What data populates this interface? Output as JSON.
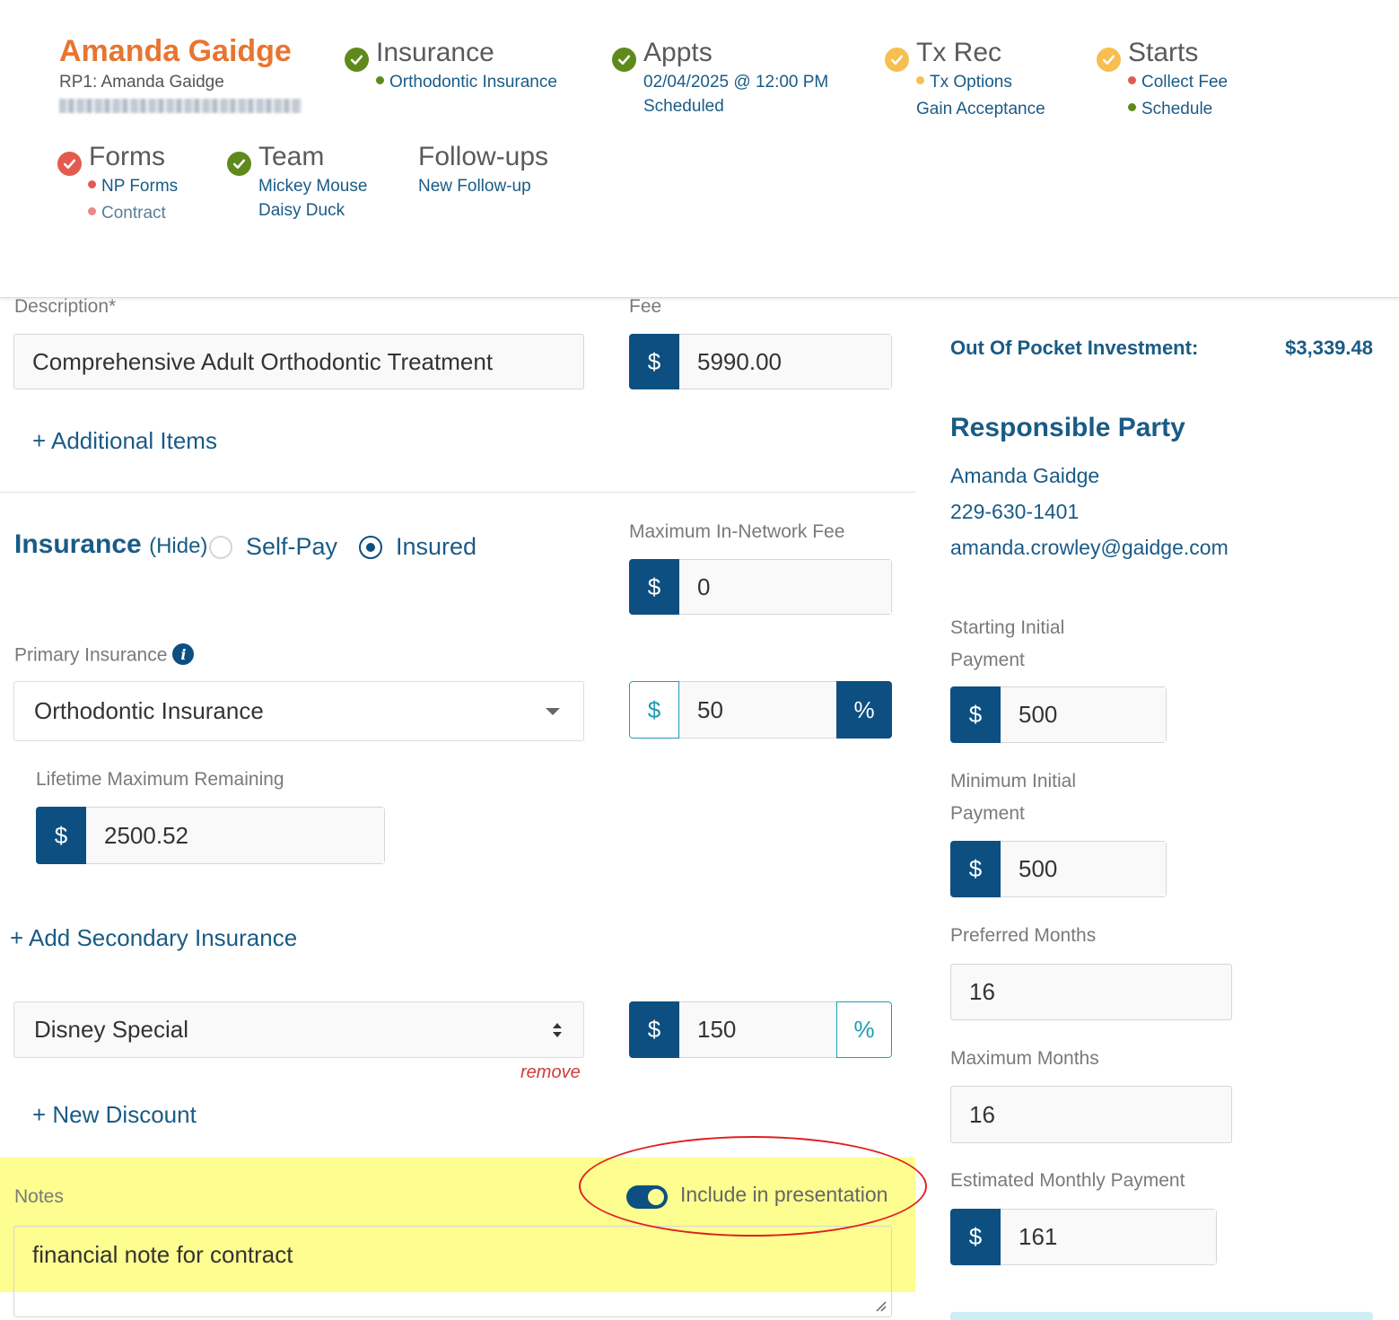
{
  "patient": {
    "name": "Amanda Gaidge",
    "rp": "RP1: Amanda Gaidge"
  },
  "stages": {
    "insurance": {
      "title": "Insurance",
      "status": "complete",
      "items": [
        "Orthodontic Insurance"
      ]
    },
    "appts": {
      "title": "Appts",
      "status": "complete",
      "items": [
        "02/04/2025 @ 12:00 PM",
        "Scheduled"
      ]
    },
    "txrec": {
      "title": "Tx Rec",
      "status": "pending",
      "items": [
        "Tx Options",
        "Gain Acceptance"
      ]
    },
    "starts": {
      "title": "Starts",
      "status": "pending",
      "items": [
        "Collect Fee",
        "Schedule"
      ]
    },
    "forms": {
      "title": "Forms",
      "status": "incomplete",
      "items": [
        "NP Forms",
        "Contract"
      ]
    },
    "team": {
      "title": "Team",
      "status": "complete",
      "items": [
        "Mickey Mouse",
        "Daisy Duck"
      ]
    },
    "followups": {
      "title": "Follow-ups",
      "items": [
        "New Follow-up"
      ]
    }
  },
  "form": {
    "description_label": "Description*",
    "description_value": "Comprehensive Adult Orthodontic Treatment",
    "fee_label": "Fee",
    "fee_value": "5990.00",
    "additional_items": "+ Additional Items",
    "insurance_heading": "Insurance",
    "insurance_hide": "(Hide)",
    "self_pay": "Self-Pay",
    "insured": "Insured",
    "max_in_network_label": "Maximum In-Network Fee",
    "max_in_network_value": "0",
    "primary_insurance_label": "Primary Insurance",
    "primary_insurance_value": "Orthodontic Insurance",
    "coverage_value": "50",
    "lifetime_max_label": "Lifetime Maximum Remaining",
    "lifetime_max_value": "2500.52",
    "add_secondary": "+ Add Secondary Insurance",
    "discount_value": "Disney Special",
    "discount_amount": "150",
    "remove": "remove",
    "new_discount": "+ New Discount",
    "notes_label": "Notes",
    "include_presentation": "Include in presentation",
    "notes_value": "financial note for contract",
    "currency_symbol": "$",
    "percent_symbol": "%"
  },
  "summary": {
    "oop_label": "Out Of Pocket Investment:",
    "oop_value": "$3,339.48",
    "rp_heading": "Responsible Party",
    "rp_name": "Amanda Gaidge",
    "rp_phone": "229-630-1401",
    "rp_email": "amanda.crowley@gaidge.com",
    "starting_initial_label_1": "Starting Initial",
    "starting_initial_label_2": "Payment",
    "starting_initial_value": "500",
    "minimum_initial_label_1": "Minimum Initial",
    "minimum_initial_label_2": "Payment",
    "minimum_initial_value": "500",
    "preferred_months_label": "Preferred Months",
    "preferred_months_value": "16",
    "maximum_months_label": "Maximum Months",
    "maximum_months_value": "16",
    "estimated_monthly_label": "Estimated Monthly Payment",
    "estimated_monthly_value": "161"
  },
  "colors": {
    "brand_orange": "#e8752f",
    "brand_blue": "#0d4f80",
    "link_blue": "#1a5b86",
    "teal": "#1d9bb5",
    "status_green": "#5e8a1c",
    "status_yellow": "#f6bf4f",
    "status_red": "#e35b4f",
    "highlight_yellow": "#fdfd90",
    "annotation_red": "#e02020"
  }
}
